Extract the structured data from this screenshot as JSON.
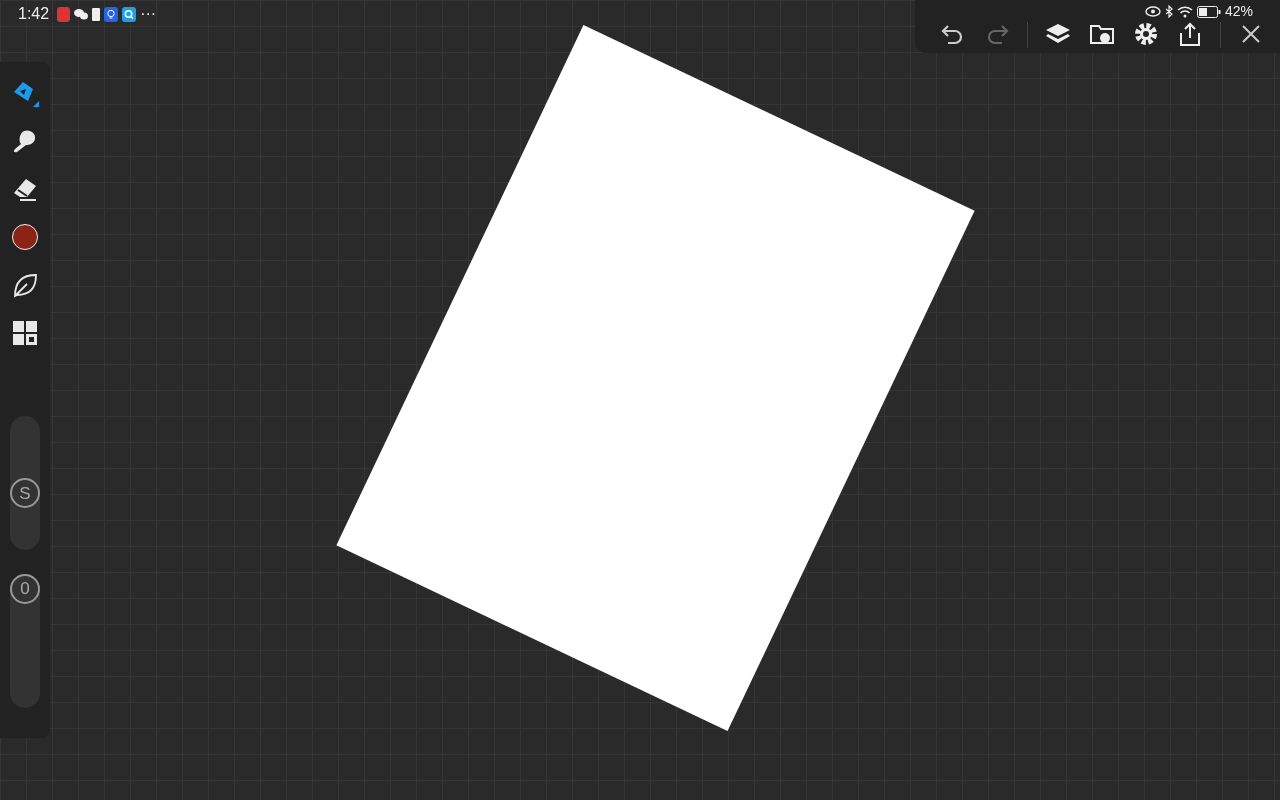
{
  "status_bar": {
    "time": "1:42",
    "more": "···",
    "battery": "42%"
  },
  "toolbar": {
    "undo": {
      "disabled": false
    },
    "redo": {
      "disabled": true
    }
  },
  "tools": [
    {
      "kind": "brush",
      "selected": true
    },
    {
      "kind": "smudge",
      "selected": false
    },
    {
      "kind": "eraser",
      "selected": false
    },
    {
      "kind": "color",
      "color": "#8b2316"
    },
    {
      "kind": "leaf",
      "selected": false
    },
    {
      "kind": "gallery",
      "selected": false
    }
  ],
  "sliders": [
    {
      "label": "S",
      "level": 0.4
    },
    {
      "label": "0",
      "level": 1
    }
  ]
}
